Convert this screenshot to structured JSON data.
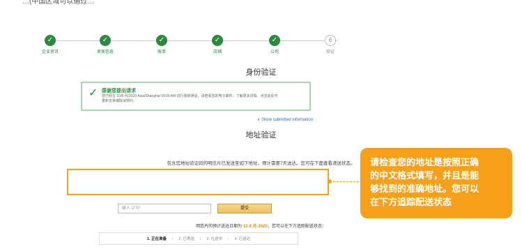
{
  "top_caption": "…(中国区域可以通过…",
  "steps": [
    {
      "label": "企业资讯",
      "done": true
    },
    {
      "label": "卖家信息",
      "done": true
    },
    {
      "label": "账单",
      "done": true
    },
    {
      "label": "店铺",
      "done": true
    },
    {
      "label": "公司",
      "done": true
    },
    {
      "label": "验证",
      "done": false,
      "number": "6"
    }
  ],
  "identity_title": "身份验证",
  "success": {
    "heading": "感谢您提出请求",
    "body_line1": "您已经在 10/8 月/2020 Asia/Shanghai 09:00 AM 进行视频通话，请查看您的电子邮件，了解更多详情。点击此处可",
    "body_line2": "重新安排或取消预约。"
  },
  "show_submitted": "∨ Show submitted information",
  "address_title": "地址验证",
  "address_note": "包含您地址验证码的明信片已发送至如下地址，预计需要7天送达。您可在下面查看递送状态。",
  "address_value": "",
  "otp_placeholder": "输入 OTP",
  "submit_label": "提交",
  "eta_prefix": "明信片的预计送达日期为",
  "eta_date": "12-8 月-2020",
  "eta_suffix": "，您可以在下方追踪配送状态：",
  "statuses": [
    "1. 正在准备",
    "2. 已寄送",
    "3. 在途中",
    "4. 已送达"
  ],
  "callout_lines": [
    "请检查您的地址是按照正确",
    "的中文格式填写，并且是能",
    "够找到的准确地址。您可以",
    "在下方追踪配送状态"
  ]
}
